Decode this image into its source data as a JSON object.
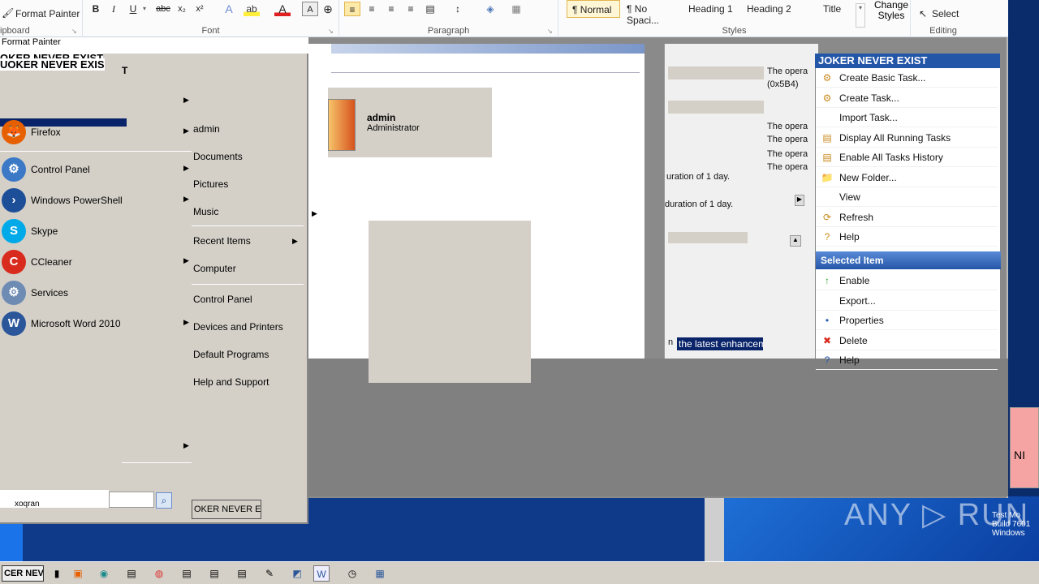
{
  "ribbon": {
    "format_painter": "Format Painter",
    "clipboard_label": "ipboard",
    "font_label": "Font",
    "paragraph_label": "Paragraph",
    "styles_label": "Styles",
    "editing_label": "Editing",
    "bold": "B",
    "italic": "I",
    "underline": "U",
    "strike": "abc",
    "subscript": "x₂",
    "superscript": "x²",
    "styles": [
      "¶ Normal",
      "¶ No Spaci...",
      "Heading 1",
      "Heading 2",
      "Title"
    ],
    "change_styles": "Change Styles",
    "select": "Select"
  },
  "start_menu": {
    "top_label": "Format Painter",
    "glitch_text_1": "OKER NEVER EXIST",
    "glitch_text_2": "UOKER NEVER EXIS",
    "cursor_glyph": "T",
    "programs": [
      {
        "label": "Firefox",
        "icon": "firefox-icon",
        "color": "#e66000",
        "glyph": "🦊"
      },
      {
        "label": "Control Panel",
        "icon": "control-panel-icon",
        "color": "#3b79c6",
        "glyph": "⚙"
      },
      {
        "label": "Windows PowerShell",
        "icon": "powershell-icon",
        "color": "#1d4f99",
        "glyph": "›"
      },
      {
        "label": "Skype",
        "icon": "skype-icon",
        "color": "#00a9e8",
        "glyph": "S"
      },
      {
        "label": "CCleaner",
        "icon": "ccleaner-icon",
        "color": "#d82b1e",
        "glyph": "C"
      },
      {
        "label": "Services",
        "icon": "services-icon",
        "color": "#6d8bb3",
        "glyph": "⚙"
      },
      {
        "label": "Microsoft Word 2010",
        "icon": "word-icon",
        "color": "#2b579a",
        "glyph": "W"
      }
    ],
    "places": [
      "admin",
      "Documents",
      "Pictures",
      "Music",
      "Recent Items",
      "Computer",
      "Control Panel",
      "Devices and Printers",
      "Default Programs",
      "Help and Support"
    ],
    "search_placeholder": "",
    "search_left_text": "xoqran",
    "shutdown_label": "OKER NEVER EXIS"
  },
  "user": {
    "name": "admin",
    "role": "Administrator"
  },
  "middle_panel": {
    "lines": [
      "The opera",
      "(0x5B4)",
      "The opera",
      "The opera",
      "The opera",
      "The opera"
    ],
    "duration_1": "uration of 1 day.",
    "duration_2": "duration of 1 day.",
    "highlight": "the latest enhancem",
    "highlight_prefix": "n"
  },
  "actions_pane": {
    "title_glitch": "JOKER NEVER EXIST",
    "items": [
      {
        "label": "Create Basic Task...",
        "icon": "create-basic-task-icon",
        "glyph": "⚙"
      },
      {
        "label": "Create Task...",
        "icon": "create-task-icon",
        "glyph": "⚙"
      },
      {
        "label": "Import Task...",
        "icon": "import-task-icon",
        "glyph": ""
      },
      {
        "label": "Display All Running Tasks",
        "icon": "running-tasks-icon",
        "glyph": "▤"
      },
      {
        "label": "Enable All Tasks History",
        "icon": "tasks-history-icon",
        "glyph": "▤"
      },
      {
        "label": "New Folder...",
        "icon": "folder-icon",
        "glyph": "📁"
      },
      {
        "label": "View",
        "icon": "view-icon",
        "glyph": ""
      },
      {
        "label": "Refresh",
        "icon": "refresh-icon",
        "glyph": "⟳"
      },
      {
        "label": "Help",
        "icon": "help-icon",
        "glyph": "?"
      }
    ],
    "selected_header": "Selected Item",
    "selected_items": [
      {
        "label": "Enable",
        "icon": "enable-icon",
        "glyph": "↑"
      },
      {
        "label": "Export...",
        "icon": "export-icon",
        "glyph": ""
      },
      {
        "label": "Properties",
        "icon": "properties-icon",
        "glyph": "•"
      },
      {
        "label": "Delete",
        "icon": "delete-icon",
        "glyph": "✖"
      },
      {
        "label": "Help",
        "icon": "help-icon-2",
        "glyph": "?"
      }
    ]
  },
  "taskbar": {
    "start_label": "CER NEVE"
  },
  "side": {
    "pink_text": "NI",
    "watermark": "ANY ▷ RUN",
    "build_text": "Test Mo Build 7601 Windows"
  },
  "colors": {
    "selection": "#0a246a",
    "header_blue": "#2456a8",
    "classic_gray": "#d4d0c8"
  }
}
